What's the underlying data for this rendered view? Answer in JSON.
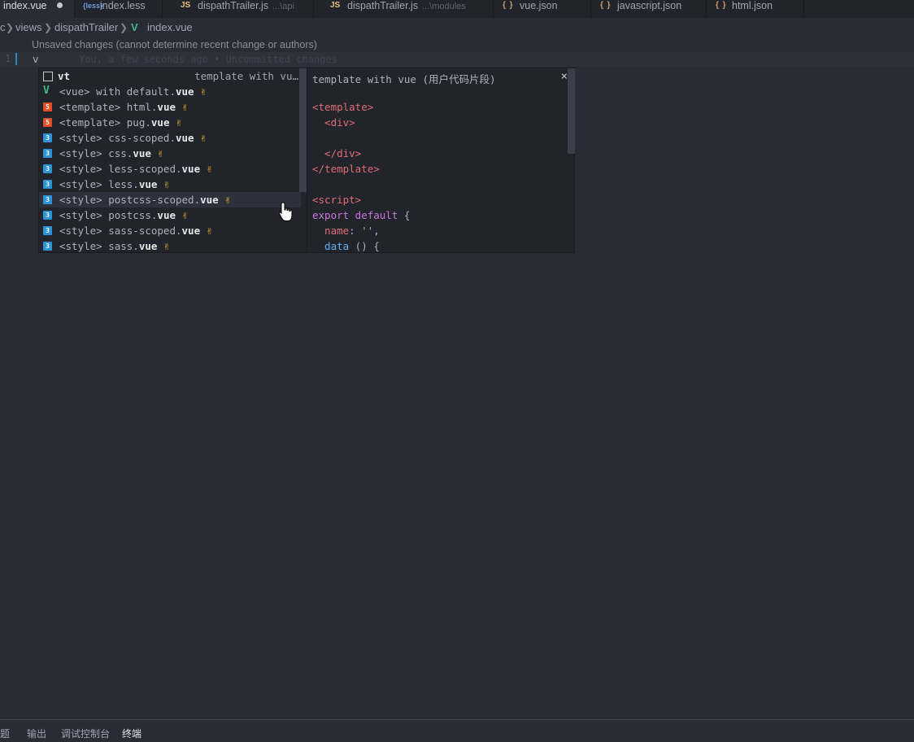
{
  "tabs": [
    {
      "label": "index.vue",
      "icon": "vue-icon",
      "active": true,
      "dirty": true
    },
    {
      "label": "index.less",
      "icon": "less-icon",
      "icon_text": "{less}"
    },
    {
      "label": "dispathTrailer.js",
      "icon": "js-icon",
      "icon_text": "JS",
      "description": "...\\api"
    },
    {
      "label": "dispathTrailer.js",
      "icon": "js-icon",
      "icon_text": "JS",
      "description": "...\\modules"
    },
    {
      "label": "vue.json",
      "icon": "json-icon",
      "icon_text": "{ }"
    },
    {
      "label": "javascript.json",
      "icon": "json-icon",
      "icon_text": "{ }"
    },
    {
      "label": "html.json",
      "icon": "json-icon",
      "icon_text": "{ }"
    }
  ],
  "breadcrumb": {
    "items": [
      "c",
      "views",
      "dispathTrailer",
      "index.vue"
    ],
    "file_icon": "V"
  },
  "editor": {
    "codelens": "Unsaved changes (cannot determine recent change or authors)",
    "line_number": "1",
    "line_text": "v",
    "blame": "You, a few seconds ago • Uncommitted changes"
  },
  "suggest": {
    "items": [
      {
        "kind": "snippet",
        "kind_icon": "",
        "prefix": "",
        "match": "vt",
        "suffix": "",
        "detail": "template with vu…",
        "hand": ""
      },
      {
        "kind": "vue",
        "kind_icon": "V",
        "prefix": "<vue> with default.",
        "match": "vue",
        "suffix": " ",
        "hand": "✌"
      },
      {
        "kind": "html",
        "kind_icon": "5",
        "prefix": "<template> html.",
        "match": "vue",
        "suffix": " ",
        "hand": "✌"
      },
      {
        "kind": "html",
        "kind_icon": "5",
        "prefix": "<template> pug.",
        "match": "vue",
        "suffix": " ",
        "hand": "✌"
      },
      {
        "kind": "css",
        "kind_icon": "3",
        "prefix": "<style> css-scoped.",
        "match": "vue",
        "suffix": " ",
        "hand": "✌"
      },
      {
        "kind": "css",
        "kind_icon": "3",
        "prefix": "<style> css.",
        "match": "vue",
        "suffix": " ",
        "hand": "✌"
      },
      {
        "kind": "css",
        "kind_icon": "3",
        "prefix": "<style> less-scoped.",
        "match": "vue",
        "suffix": " ",
        "hand": "✌"
      },
      {
        "kind": "css",
        "kind_icon": "3",
        "prefix": "<style> less.",
        "match": "vue",
        "suffix": " ",
        "hand": "✌"
      },
      {
        "kind": "css",
        "kind_icon": "3",
        "prefix": "<style> postcss-scoped.",
        "match": "vue",
        "suffix": " ",
        "hand": "✌"
      },
      {
        "kind": "css",
        "kind_icon": "3",
        "prefix": "<style> postcss.",
        "match": "vue",
        "suffix": " ",
        "hand": "✌"
      },
      {
        "kind": "css",
        "kind_icon": "3",
        "prefix": "<style> sass-scoped.",
        "match": "vue",
        "suffix": " ",
        "hand": "✌"
      },
      {
        "kind": "css",
        "kind_icon": "3",
        "prefix": "<style> sass.",
        "match": "vue",
        "suffix": " ",
        "hand": "✌"
      }
    ],
    "details": {
      "header": "template with vue (用户代码片段)",
      "close": "×",
      "code": {
        "l1": "<template>",
        "l2": "  <div>",
        "l3": "",
        "l4": "  </div>",
        "l5": "</template>",
        "l6": "",
        "l7": "<script>",
        "l8_kw": "export default",
        "l8_rest": " {",
        "l9_prop": "  name",
        "l9_rest": ": ",
        "l9_str": "''",
        "l9_end": ",",
        "l10_fn": "  data",
        "l10_rest": " () {"
      }
    }
  },
  "panel": {
    "tabs": [
      "问题",
      "输出",
      "调试控制台",
      "终端"
    ],
    "active": "终端"
  },
  "colors": {
    "editor_bg": "#282c34",
    "tabbar_bg": "#21252b",
    "accent": "#2f87b9",
    "vue_green": "#42b883"
  }
}
